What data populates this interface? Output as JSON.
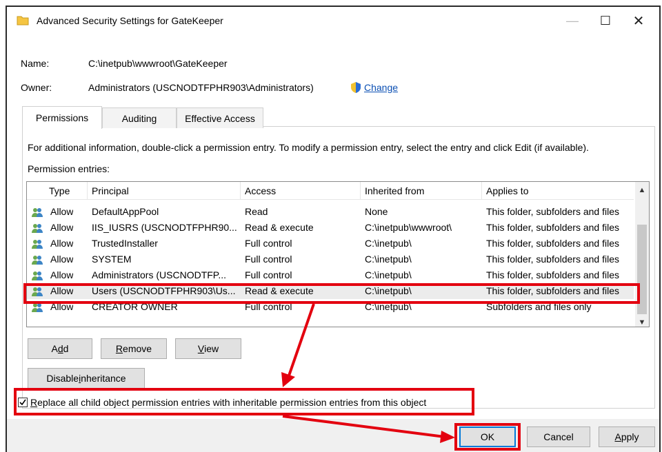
{
  "window": {
    "title": "Advanced Security Settings for GateKeeper",
    "minimize_glyph": "—",
    "maximize_glyph": "☐",
    "close_glyph": "✕"
  },
  "info": {
    "name_label": "Name:",
    "name_value": "C:\\inetpub\\wwwroot\\GateKeeper",
    "owner_label": "Owner:",
    "owner_value": "Administrators (USCNODTFPHR903\\Administrators)",
    "change_label": "Change"
  },
  "tabs": [
    {
      "label": "Permissions",
      "active": true
    },
    {
      "label": "Auditing",
      "active": false
    },
    {
      "label": "Effective Access",
      "active": false
    }
  ],
  "permissions": {
    "help_text": "For additional information, double-click a permission entry. To modify a permission entry, select the entry and click Edit (if available).",
    "entries_label": "Permission entries:",
    "columns": [
      "Type",
      "Principal",
      "Access",
      "Inherited from",
      "Applies to"
    ],
    "rows": [
      {
        "type": "Allow",
        "principal": "DefaultAppPool",
        "access": "Read",
        "inherited": "None",
        "applies": "This folder, subfolders and files"
      },
      {
        "type": "Allow",
        "principal": "IIS_IUSRS (USCNODTFPHR90...",
        "access": "Read & execute",
        "inherited": "C:\\inetpub\\wwwroot\\",
        "applies": "This folder, subfolders and files"
      },
      {
        "type": "Allow",
        "principal": "TrustedInstaller",
        "access": "Full control",
        "inherited": "C:\\inetpub\\",
        "applies": "This folder, subfolders and files"
      },
      {
        "type": "Allow",
        "principal": "SYSTEM",
        "access": "Full control",
        "inherited": "C:\\inetpub\\",
        "applies": "This folder, subfolders and files"
      },
      {
        "type": "Allow",
        "principal": "Administrators (USCNODTFP...",
        "access": "Full control",
        "inherited": "C:\\inetpub\\",
        "applies": "This folder, subfolders and files"
      },
      {
        "type": "Allow",
        "principal": "Users (USCNODTFPHR903\\Us...",
        "access": "Read & execute",
        "inherited": "C:\\inetpub\\",
        "applies": "This folder, subfolders and files",
        "selected": true
      },
      {
        "type": "Allow",
        "principal": "CREATOR OWNER",
        "access": "Full control",
        "inherited": "C:\\inetpub\\",
        "applies": "Subfolders and files only"
      }
    ]
  },
  "buttons": {
    "add": {
      "pre": "A",
      "key": "d",
      "post": "d"
    },
    "remove": {
      "pre": "",
      "key": "R",
      "post": "emove"
    },
    "view": {
      "pre": "",
      "key": "V",
      "post": "iew"
    },
    "disable_inheritance": {
      "pre": "Disable ",
      "key": "i",
      "post": "nheritance"
    },
    "ok": "OK",
    "cancel": "Cancel",
    "apply": {
      "pre": "",
      "key": "A",
      "post": "pply"
    }
  },
  "replace_checkbox": {
    "checked": true,
    "label_key": "R",
    "label_rest": "eplace all child object permission entries with inheritable permission entries from this object"
  },
  "colors": {
    "annotation": "#e3000f",
    "link": "#0a4fb3"
  },
  "icons": {
    "title": "folder-icon",
    "owner": "shield-icon",
    "principal": "user-group-icon"
  }
}
